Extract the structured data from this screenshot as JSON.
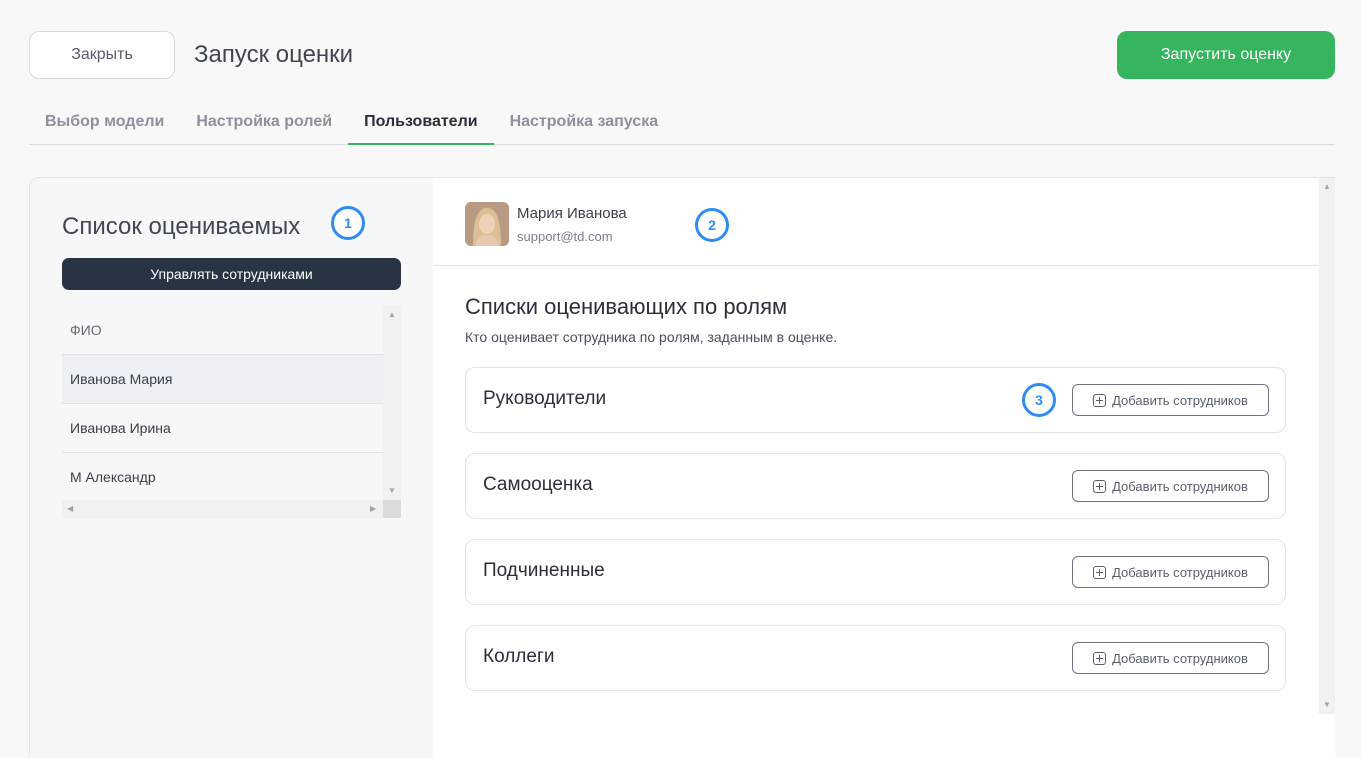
{
  "header": {
    "close_label": "Закрыть",
    "title": "Запуск оценки",
    "launch_label": "Запустить оценку"
  },
  "tabs": [
    {
      "label": "Выбор модели"
    },
    {
      "label": "Настройка ролей"
    },
    {
      "label": "Пользователи",
      "active": true
    },
    {
      "label": "Настройка запуска"
    }
  ],
  "left": {
    "title": "Список оцениваемых",
    "badge": "1",
    "manage_label": "Управлять сотрудниками",
    "column_header": "ФИО",
    "rows": [
      "Иванова Мария",
      "Иванова Ирина",
      "М Александр"
    ]
  },
  "user": {
    "name": "Мария Иванова",
    "email": "support@td.com",
    "badge": "2"
  },
  "section": {
    "title": "Списки оценивающих по ролям",
    "subtitle": "Кто оценивает сотрудника по ролям, заданным в оценке."
  },
  "roles": [
    {
      "name": "Руководители",
      "add_label": "Добавить сотрудников",
      "badge": "3"
    },
    {
      "name": "Самооценка",
      "add_label": "Добавить сотрудников"
    },
    {
      "name": "Подчиненные",
      "add_label": "Добавить сотрудников"
    },
    {
      "name": "Коллеги",
      "add_label": "Добавить сотрудников"
    }
  ],
  "colors": {
    "accent": "#35b55d",
    "badge": "#2f8cf0",
    "dark_button": "#283343"
  }
}
